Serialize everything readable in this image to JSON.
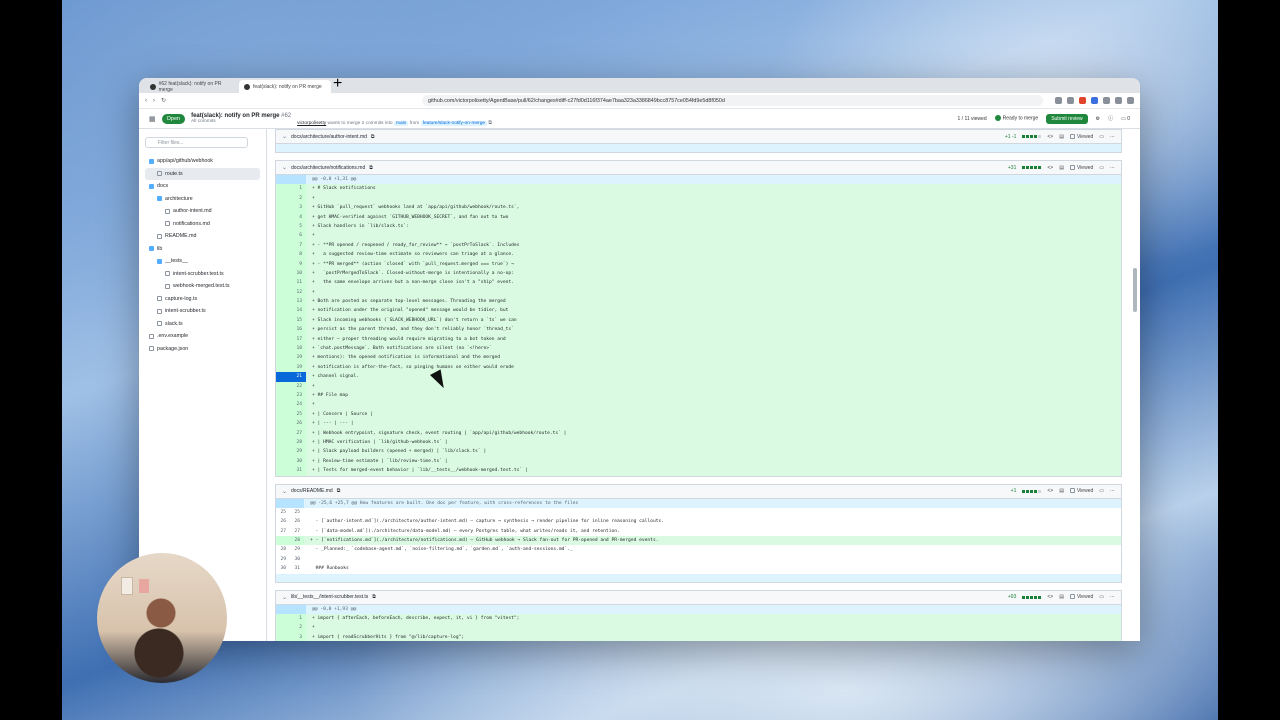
{
  "browser": {
    "tabs": [
      {
        "label": "#62 feat(slack): notify on PR merge",
        "active": false
      },
      {
        "label": "feat(slack): notify on PR merge",
        "active": true
      }
    ],
    "url": "github.com/victorpolisetty/AgentBase/pull/62/changes#diff-c27fd0d116f374ae7baa323a3386849bcc8757ce054fd9e5d8f050d"
  },
  "pr": {
    "status": "Open",
    "title": "feat(slack): notify on PR merge",
    "number": "#62",
    "commits_label": "All commits",
    "author": "victorpolisetty",
    "merge_text": "wants to merge 2 commits into",
    "base_branch": "main",
    "from_label": "from",
    "head_branch": "feature/slack-notify-on-merge",
    "viewed_count": "1 / 11 viewed",
    "ready_label": "Ready to merge",
    "submit_label": "Submit review",
    "comment_count": "0"
  },
  "sidebar": {
    "filter_placeholder": "Filter files...",
    "items": [
      {
        "label": "app/api/github/webhook",
        "type": "folder",
        "depth": 0
      },
      {
        "label": "route.ts",
        "type": "file",
        "depth": 1,
        "active": true
      },
      {
        "label": "docs",
        "type": "folder",
        "depth": 0
      },
      {
        "label": "architecture",
        "type": "folder",
        "depth": 1
      },
      {
        "label": "author-intent.md",
        "type": "file",
        "depth": 2
      },
      {
        "label": "notifications.md",
        "type": "file",
        "depth": 2
      },
      {
        "label": "README.md",
        "type": "file",
        "depth": 1
      },
      {
        "label": "lib",
        "type": "folder",
        "depth": 0
      },
      {
        "label": "__tests__",
        "type": "folder",
        "depth": 1
      },
      {
        "label": "intent-scrubber.test.ts",
        "type": "file",
        "depth": 2
      },
      {
        "label": "webhook-merged.test.ts",
        "type": "file",
        "depth": 2
      },
      {
        "label": "capture-log.ts",
        "type": "file",
        "depth": 1
      },
      {
        "label": "intent-scrubber.ts",
        "type": "file",
        "depth": 1
      },
      {
        "label": "slack.ts",
        "type": "file",
        "depth": 1
      },
      {
        "label": ".env.example",
        "type": "file",
        "depth": 0
      },
      {
        "label": "package.json",
        "type": "file",
        "depth": 0
      }
    ]
  },
  "files": [
    {
      "path": "docs/architecture/author-intent.md",
      "stat": "+1 -1",
      "viewed_label": "Viewed",
      "lines": []
    },
    {
      "path": "docs/architecture/notifications.md",
      "stat": "+31",
      "viewed_label": "Viewed",
      "lines": [
        {
          "n": "",
          "text": "@@ -0,0 +1,31 @@",
          "kind": "hunk"
        },
        {
          "n": "1",
          "text": "+ # Slack notifications",
          "kind": "add"
        },
        {
          "n": "2",
          "text": "+",
          "kind": "add"
        },
        {
          "n": "3",
          "text": "+ GitHub `pull_request` webhooks land at `app/api/github/webhook/route.ts`,",
          "kind": "add"
        },
        {
          "n": "4",
          "text": "+ get HMAC-verified against `GITHUB_WEBHOOK_SECRET`, and fan out to two",
          "kind": "add"
        },
        {
          "n": "5",
          "text": "+ Slack handlers in `lib/slack.ts`:",
          "kind": "add"
        },
        {
          "n": "6",
          "text": "+",
          "kind": "add"
        },
        {
          "n": "7",
          "text": "+ - **PR opened / reopened / ready_for_review** → `postPrToSlack`. Includes",
          "kind": "add"
        },
        {
          "n": "8",
          "text": "+   a suggested review-time estimate so reviewers can triage at a glance.",
          "kind": "add"
        },
        {
          "n": "9",
          "text": "+ - **PR merged** (action `closed` with `pull_request.merged === true`) →",
          "kind": "add"
        },
        {
          "n": "10",
          "text": "+   `postPrMergedToSlack`. Closed-without-merge is intentionally a no-op:",
          "kind": "add"
        },
        {
          "n": "11",
          "text": "+   the same envelope arrives but a non-merge close isn't a \"ship\" event.",
          "kind": "add"
        },
        {
          "n": "12",
          "text": "+",
          "kind": "add"
        },
        {
          "n": "13",
          "text": "+ Both are posted as separate top-level messages. Threading the merged",
          "kind": "add"
        },
        {
          "n": "14",
          "text": "+ notification under the original \"opened\" message would be tidier, but",
          "kind": "add"
        },
        {
          "n": "15",
          "text": "+ Slack incoming webhooks (`SLACK_WEBHOOK_URL`) don't return a `ts` we can",
          "kind": "add"
        },
        {
          "n": "16",
          "text": "+ persist as the parent thread, and they don't reliably honor `thread_ts`",
          "kind": "add"
        },
        {
          "n": "17",
          "text": "+ either — proper threading would require migrating to a bot token and",
          "kind": "add"
        },
        {
          "n": "18",
          "text": "+ `chat.postMessage`. Both notifications are silent (no `<!here>`",
          "kind": "add"
        },
        {
          "n": "19",
          "text": "+ mentions): the opened notification is informational and the merged",
          "kind": "add"
        },
        {
          "n": "19",
          "text": "+ notification is after-the-fact, so pinging humans on either would erode",
          "kind": "add"
        },
        {
          "n": "21",
          "text": "+ channel signal.",
          "kind": "add",
          "highlight": true
        },
        {
          "n": "22",
          "text": "+",
          "kind": "add"
        },
        {
          "n": "23",
          "text": "+ ## File map",
          "kind": "add"
        },
        {
          "n": "24",
          "text": "+",
          "kind": "add"
        },
        {
          "n": "25",
          "text": "+ | Concern | Source |",
          "kind": "add"
        },
        {
          "n": "26",
          "text": "+ | --- | --- |",
          "kind": "add"
        },
        {
          "n": "27",
          "text": "+ | Webhook entrypoint, signature check, event routing | `app/api/github/webhook/route.ts` |",
          "kind": "add"
        },
        {
          "n": "28",
          "text": "+ | HMAC verification | `lib/github-webhook.ts` |",
          "kind": "add"
        },
        {
          "n": "29",
          "text": "+ | Slack payload builders (opened + merged) | `lib/slack.ts` |",
          "kind": "add"
        },
        {
          "n": "30",
          "text": "+ | Review-time estimate | `lib/review-time.ts` |",
          "kind": "add"
        },
        {
          "n": "31",
          "text": "+ | Tests for merged-event behavior | `lib/__tests__/webhook-merged.test.ts` |",
          "kind": "add"
        }
      ]
    },
    {
      "path": "docs/README.md",
      "stat": "+1",
      "viewed_label": "Viewed",
      "lines": [
        {
          "n": "",
          "n2": "",
          "text": "@@ -25,6 +25,7 @@ How features are built. One doc per feature, with cross-references to the files",
          "kind": "hunk"
        },
        {
          "n": "25",
          "n2": "25",
          "text": "",
          "kind": "ctx"
        },
        {
          "n": "26",
          "n2": "26",
          "text": "  - [`author-intent.md`](./architecture/author-intent.md) — capture → synthesis → render pipeline for inline reasoning callouts.",
          "kind": "ctx"
        },
        {
          "n": "27",
          "n2": "27",
          "text": "  - [`data-model.md`](./architecture/data-model.md) — every Postgres table, what writes/reads it, and retention.",
          "kind": "ctx"
        },
        {
          "n": "",
          "n2": "28",
          "text": "+ - [`notifications.md`](./architecture/notifications.md) — GitHub webhook → Slack fan-out for PR-opened and PR-merged events.",
          "kind": "add"
        },
        {
          "n": "28",
          "n2": "29",
          "text": "  - _Planned:_ `codebase-agent.md`, `noise-filtering.md`, `garden.md`, `auth-and-sessions.md`._",
          "kind": "ctx"
        },
        {
          "n": "29",
          "n2": "30",
          "text": "",
          "kind": "ctx"
        },
        {
          "n": "30",
          "n2": "31",
          "text": "  ### Runbooks",
          "kind": "ctx"
        }
      ]
    },
    {
      "path": "lib/__tests__/intent-scrubber.test.ts",
      "stat": "+93",
      "viewed_label": "Viewed",
      "lines": [
        {
          "n": "",
          "text": "@@ -0,0 +1,93 @@",
          "kind": "hunk"
        },
        {
          "n": "1",
          "text": "+ import { afterEach, beforeEach, describe, expect, it, vi } from \"vitest\";",
          "kind": "add"
        },
        {
          "n": "2",
          "text": "+",
          "kind": "add"
        },
        {
          "n": "3",
          "text": "+ import { readScrubberHits } from \"@/lib/capture-log\";",
          "kind": "add"
        }
      ]
    }
  ]
}
